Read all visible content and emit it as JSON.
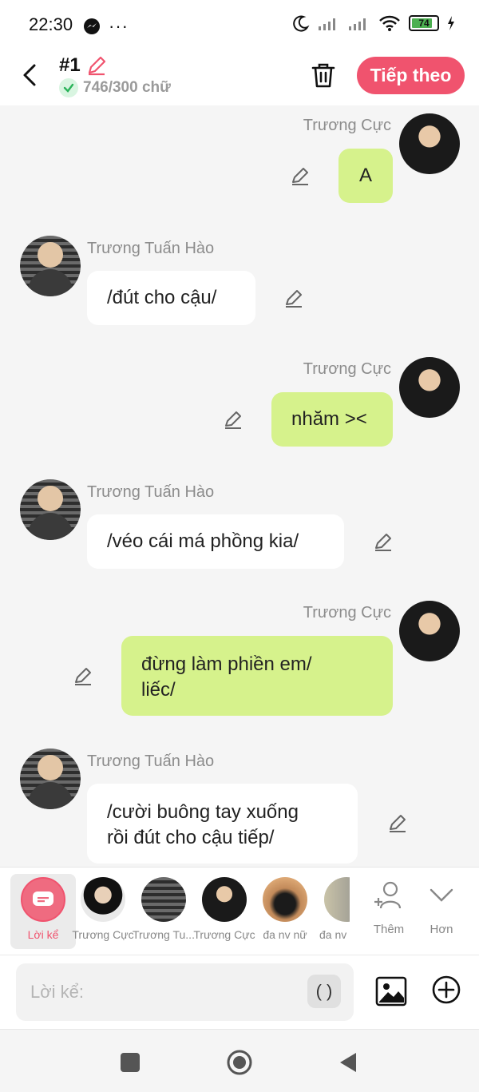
{
  "status_bar": {
    "time": "22:30",
    "battery_level": "74"
  },
  "header": {
    "title": "#1",
    "word_count": "746/300 chữ",
    "next_button": "Tiếp theo"
  },
  "messages": [
    {
      "side": "right",
      "name": "Trương Cực",
      "text": "A",
      "bubble_color": "#d6f28c"
    },
    {
      "side": "left",
      "name": "Trương Tuấn Hào",
      "text": "/đút cho cậu/",
      "bubble_color": "#ffffff"
    },
    {
      "side": "right",
      "name": "Trương Cực",
      "text": "nhăm ><",
      "bubble_color": "#d6f28c"
    },
    {
      "side": "left",
      "name": "Trương Tuấn Hào",
      "text": "/véo cái má phồng kia/",
      "bubble_color": "#ffffff"
    },
    {
      "side": "right",
      "name": "Trương Cực",
      "text_lines": [
        "đừng làm phiền em/",
        "liếc/"
      ],
      "bubble_color": "#d6f28c"
    },
    {
      "side": "left",
      "name": "Trương Tuấn Hào",
      "text_lines": [
        "/cười buông tay xuống",
        "rồi đút cho cậu tiếp/"
      ],
      "bubble_color": "#ffffff"
    }
  ],
  "character_bar": {
    "items": [
      {
        "label": "Lời kể",
        "selected": true
      },
      {
        "label": "Trương Cực"
      },
      {
        "label": "Trương Tu..."
      },
      {
        "label": "Trương Cực"
      },
      {
        "label": "đa nv nữ"
      },
      {
        "label": "đa nv"
      }
    ],
    "add_label": "Thêm",
    "more_label": "Hơn"
  },
  "composer": {
    "placeholder": "Lời kể:",
    "paren_label": "( )"
  },
  "colors": {
    "accent": "#f0536e",
    "right_bubble": "#d6f28c",
    "left_bubble": "#ffffff",
    "background": "#f5f5f5"
  }
}
